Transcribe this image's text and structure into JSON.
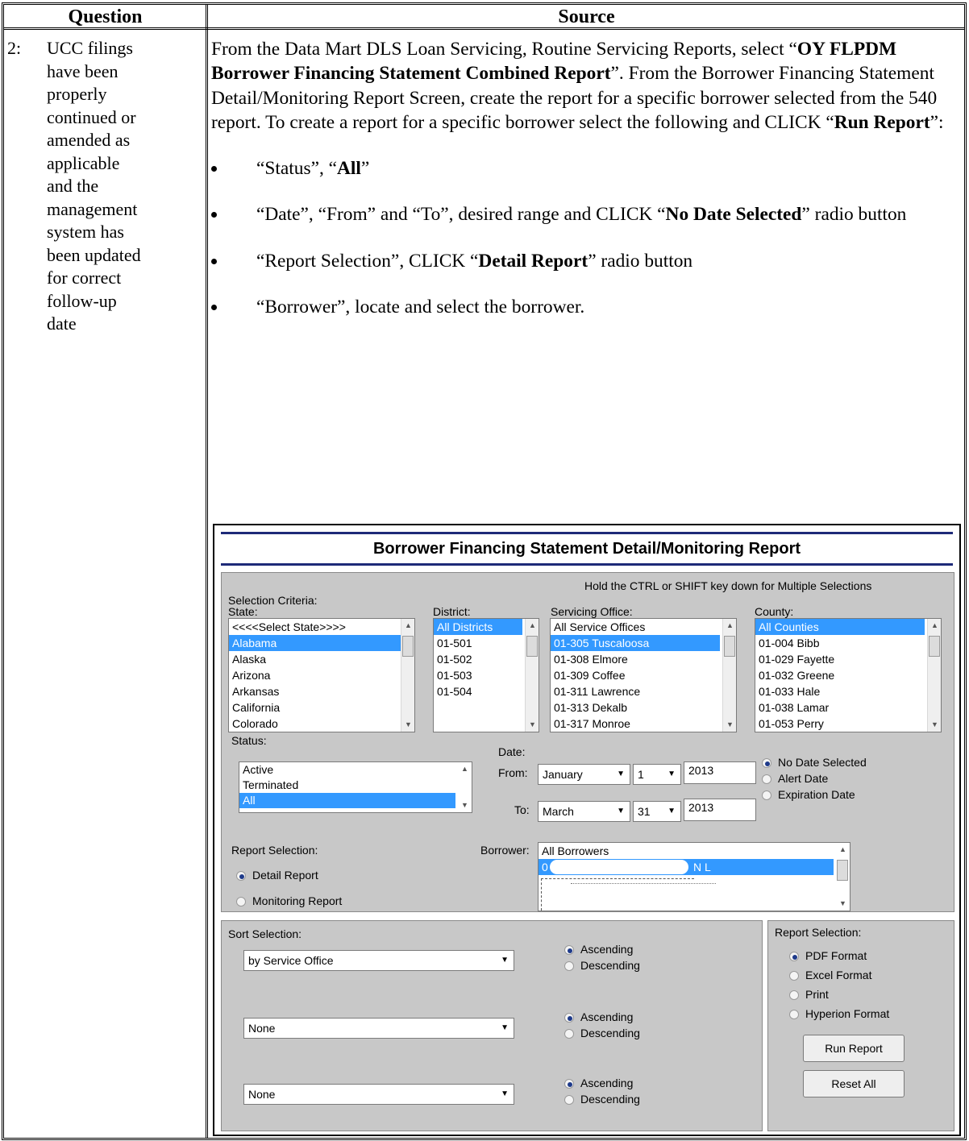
{
  "table": {
    "headers": {
      "question": "Question",
      "source": "Source"
    },
    "question_number": "2:",
    "question_lines": [
      "UCC filings",
      "have been",
      "properly",
      "continued or",
      "amended as",
      "applicable",
      "and the",
      "management",
      "system has",
      "been updated",
      "for correct",
      "follow-up",
      "date"
    ],
    "intro": {
      "t1": "From the Data Mart DLS Loan Servicing, Routine Servicing Reports, select “",
      "b1": "OY FLPDM Borrower Financing Statement Combined Report",
      "t2": "”.  From the Borrower Financing Statement Detail/Monitoring Report Screen, create the report for a specific borrower selected from the 540 report.  To create a report for a specific borrower select the following and CLICK “",
      "b2": "Run Report",
      "t3": "”:"
    },
    "bullets": {
      "b1": {
        "a": "“Status”, “",
        "b": "All",
        "c": "”"
      },
      "b2": {
        "a": "“Date”, “From” and “To”, desired range and CLICK “",
        "b": "No Date Selected",
        "c": "” radio button"
      },
      "b3": {
        "a": "“Report Selection”, CLICK “",
        "b": "Detail Report",
        "c": "” radio button"
      },
      "b4": {
        "a": " “Borrower”, locate and select the borrower."
      }
    }
  },
  "screen": {
    "title": "Borrower Financing Statement Detail/Monitoring Report",
    "hint": "Hold the CTRL or SHIFT key down for Multiple Selections",
    "selection_criteria_label": "Selection Criteria:",
    "state": {
      "label": "State:",
      "items": [
        "<<<<Select State>>>>",
        "Alabama",
        "Alaska",
        "Arizona",
        "Arkansas",
        "California",
        "Colorado"
      ],
      "selected": "Alabama"
    },
    "district": {
      "label": "District:",
      "items": [
        "All Districts",
        "01-501",
        "01-502",
        "01-503",
        "01-504"
      ],
      "selected": "All Districts"
    },
    "office": {
      "label": "Servicing Office:",
      "items": [
        "All Service Offices",
        "01-305 Tuscaloosa",
        "01-308 Elmore",
        "01-309 Coffee",
        "01-311 Lawrence",
        "01-313 Dekalb",
        "01-317 Monroe"
      ],
      "selected": "01-305 Tuscaloosa"
    },
    "county": {
      "label": "County:",
      "items": [
        "All Counties",
        "01-004 Bibb",
        "01-029 Fayette",
        "01-032 Greene",
        "01-033 Hale",
        "01-038 Lamar",
        "01-053 Perry"
      ],
      "selected": "All Counties"
    },
    "status": {
      "label": "Status:",
      "items": [
        "Active",
        "Terminated",
        "All"
      ],
      "selected": "All"
    },
    "date": {
      "label": "Date:",
      "from_label": "From:",
      "from_month": "January",
      "from_day": "1",
      "from_year": "2013",
      "to_label": "To:",
      "to_month": "March",
      "to_day": "31",
      "to_year": "2013",
      "radios": [
        "No Date Selected",
        "Alert Date",
        "Expiration Date"
      ],
      "selected": "No Date Selected"
    },
    "report_selection": {
      "label": "Report Selection:",
      "options": [
        "Detail Report",
        "Monitoring Report"
      ],
      "selected": "Detail Report"
    },
    "borrower": {
      "label": "Borrower:",
      "first": "All Borrowers",
      "selected_prefix": "0",
      "selected_suffix": "N L"
    },
    "sort": {
      "label": "Sort Selection:",
      "rows": [
        {
          "value": "by Service Office",
          "asc": "Ascending",
          "desc": "Descending"
        },
        {
          "value": "None",
          "asc": "Ascending",
          "desc": "Descending"
        },
        {
          "value": "None",
          "asc": "Ascending",
          "desc": "Descending"
        }
      ]
    },
    "output": {
      "label": "Report Selection:",
      "options": [
        "PDF Format",
        "Excel Format",
        "Print",
        "Hyperion Format"
      ],
      "selected": "PDF Format"
    },
    "buttons": {
      "run": "Run Report",
      "reset": "Reset All"
    }
  }
}
